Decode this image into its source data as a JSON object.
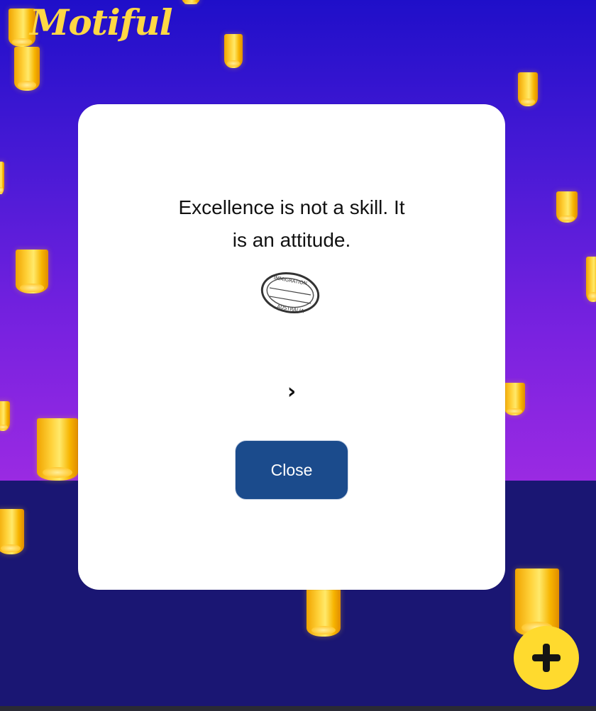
{
  "app": {
    "logo_text": "Motiful",
    "colors": {
      "sky_top": "#1f0fc9",
      "sky_bottom": "#9a2ae2",
      "ground": "#1a1673",
      "logo": "#ffd845",
      "button": "#1b4b8c",
      "fab": "#ffda2e"
    }
  },
  "modal": {
    "quote_line1": "Excellence is not a skill. It",
    "quote_line2": "is an attitude.",
    "stamp_text_top": "IMMIGRATION",
    "stamp_text_bottom": "AUSTRALIA",
    "next_icon": "chevron-right-icon",
    "close_label": "Close"
  },
  "fab": {
    "icon": "plus-icon"
  }
}
